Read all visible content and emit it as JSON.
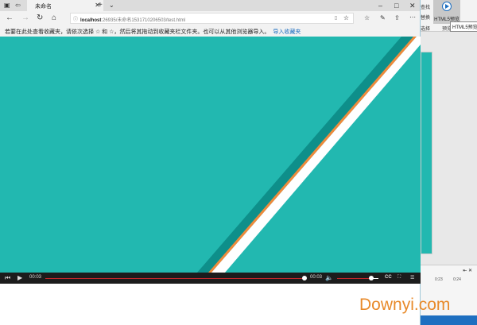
{
  "browser": {
    "tab_title": "未命名",
    "url_host": "localhost",
    "url_path": ":26935/未命名1531710206503/test.html",
    "favorites_hint": "若要在此处查看收藏夹，请依次选择 ☆ 和 ☆，然后将其拖动到收藏夹栏文件夹。也可以从其他浏览器导入。",
    "import_link": "导入收藏夹"
  },
  "player": {
    "current_time": "00:03",
    "duration": "00:03",
    "progress": 1.0,
    "volume": 0.85
  },
  "background_app": {
    "find_label": "查找",
    "replace_label": "替换",
    "select_label": "选择",
    "html5_preview_label": "HTML5预览",
    "preview_group_label": "预览",
    "tooltip": "HTML5预览",
    "ruler_ticks": [
      "0:23",
      "0:24"
    ]
  },
  "watermark": "Downyi.com",
  "colors": {
    "video_bg": "#22b8b0",
    "dark_band": "#0e8f8a",
    "orange": "#f08a3a",
    "accent": "#1e6fc0"
  }
}
